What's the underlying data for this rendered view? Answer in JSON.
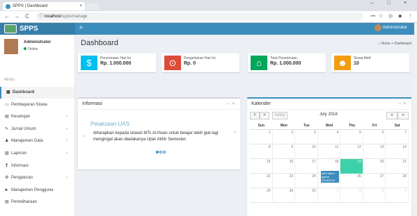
{
  "browser": {
    "tab_title": "SPPS | Dashboard",
    "url_host": "localhost",
    "url_path": "/spps/manage",
    "tab_close": "×",
    "win_min": "–",
    "win_max": "□",
    "win_close": "×",
    "back": "←",
    "forward": "→",
    "reload": "C"
  },
  "app": {
    "logo": "SPPS",
    "menu_toggle": "≡",
    "admin_name": "Administrator"
  },
  "sidebar": {
    "user_name": "Administrator",
    "user_status": "Online",
    "menu_header": "MENU",
    "items": [
      {
        "label": "Dashboard",
        "icon": "▦",
        "chevron": ""
      },
      {
        "label": "Pembayaran Siswa",
        "icon": "▭",
        "chevron": ""
      },
      {
        "label": "Keuangan",
        "icon": "▤",
        "chevron": "‹"
      },
      {
        "label": "Jurnal Umum",
        "icon": "✎",
        "chevron": "‹"
      },
      {
        "label": "Manajemen Data",
        "icon": "♟",
        "chevron": "‹"
      },
      {
        "label": "Laporan",
        "icon": "▧",
        "chevron": "‹"
      },
      {
        "label": "Informasi",
        "icon": "❢",
        "chevron": ""
      },
      {
        "label": "Pengaturan",
        "icon": "⚙",
        "chevron": "‹"
      },
      {
        "label": "Manajemen Pengguna",
        "icon": "♣",
        "chevron": ""
      },
      {
        "label": "Pemeliharaan",
        "icon": "▤",
        "chevron": ""
      }
    ]
  },
  "header": {
    "title": "Dashboard",
    "breadcrumb": "Home > Dashboard"
  },
  "info_boxes": [
    {
      "label": "Penerimaan Hari Ini",
      "value": "Rp. 1.000.000",
      "icon": "$",
      "color": "#00c0ef"
    },
    {
      "label": "Pengeluaran Hari Ini",
      "value": "Rp. 0",
      "icon": "⊙",
      "color": "#dd4b39"
    },
    {
      "label": "Total Penerimaan",
      "value": "Rp. 1.000.000",
      "icon": "⌂",
      "color": "#00a65a"
    },
    {
      "label": "Siswa Aktif",
      "value": "10",
      "icon": "☻",
      "color": "#f39c12"
    }
  ],
  "informasi": {
    "title": "Informasi",
    "minimize": "–",
    "close": "×",
    "slide_title": "Pelaksaan UAS",
    "slide_text": "diharapkan kepada siswa/i MTs Al-Ihsan untuk belajar lebih giat lagi mengingat akan diadakanya Ujian Akhir Semester.",
    "prev": "‹",
    "next": "›"
  },
  "kalender": {
    "title": "Kalender",
    "minimize": "–",
    "close": "×",
    "prev": "<",
    "next": ">",
    "today": "today",
    "month": "July 2018",
    "prev_year": "«",
    "next_year": "»",
    "days": [
      "Sun",
      "Mon",
      "Tue",
      "Wed",
      "Thu",
      "Fri",
      "Sat"
    ],
    "weeks": [
      [
        "1",
        "2",
        "3",
        "4",
        "5",
        "6",
        "7"
      ],
      [
        "8",
        "9",
        "10",
        "11",
        "12",
        "13",
        "14"
      ],
      [
        "15",
        "16",
        "17",
        "18",
        "19",
        "20",
        "21"
      ],
      [
        "22",
        "23",
        "24",
        "25",
        "26",
        "27",
        "28"
      ],
      [
        "29",
        "30",
        "31",
        "1",
        "2",
        "3",
        "4"
      ]
    ],
    "event": "akhf tahun ajaran 2018/2019"
  }
}
